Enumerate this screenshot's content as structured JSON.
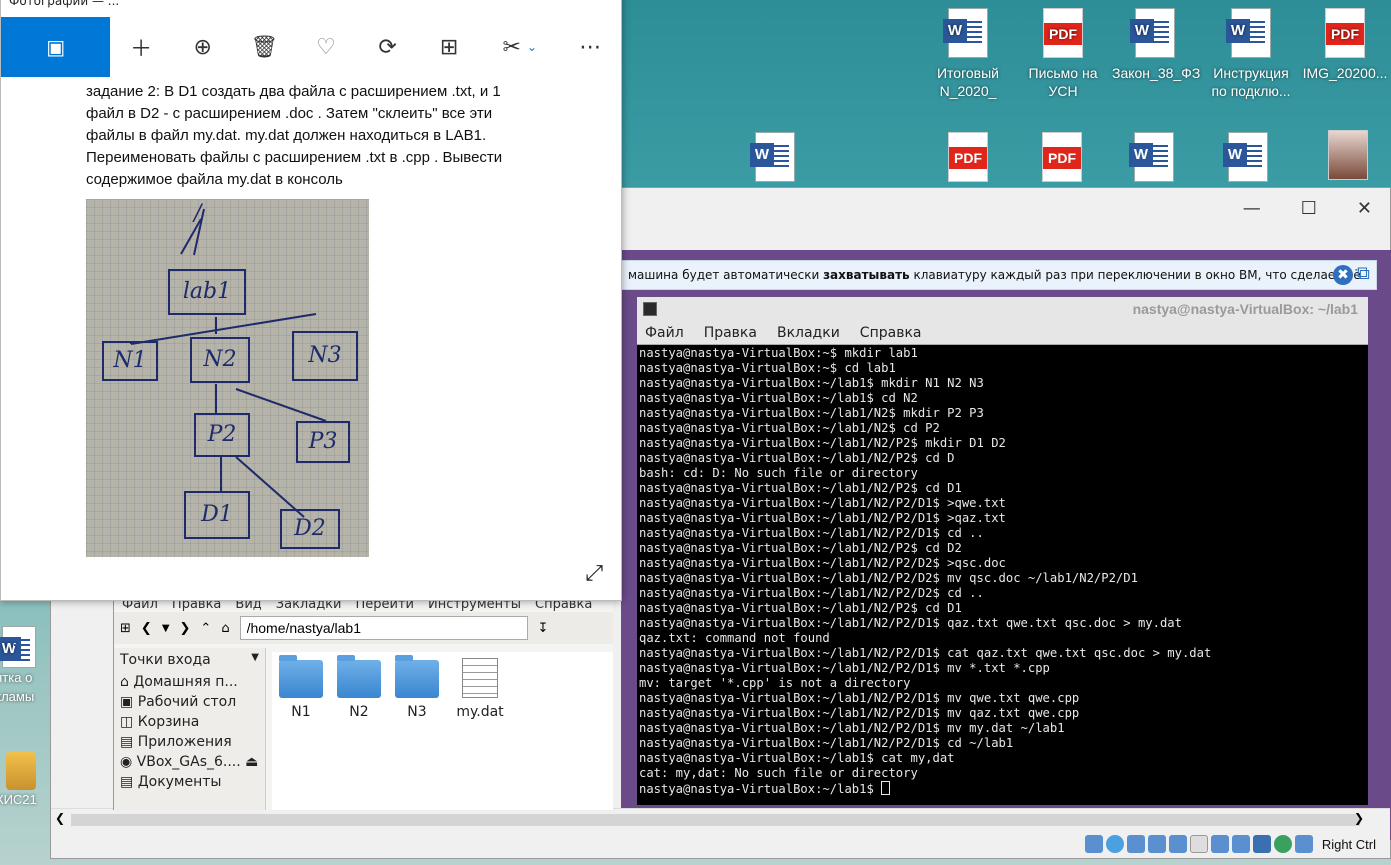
{
  "desktop": {
    "icons_row1": [
      {
        "label": "Итоговый N_2020_",
        "type": "word"
      },
      {
        "label": "Письмо на УСН",
        "type": "pdf"
      },
      {
        "label": "Закон_38_ФЗ",
        "type": "word"
      },
      {
        "label": "Инструкция по подклю...",
        "type": "word"
      },
      {
        "label": "IMG_20200...",
        "type": "pdf"
      }
    ],
    "left_icons": [
      {
        "label": "иятка о екламы"
      },
      {
        "label": "КИС21"
      }
    ]
  },
  "photos": {
    "title": "Фотографии — ...",
    "task_text": "задание 2: В D1 создать два файла с расширением .txt, и 1 файл в D2 - с расширением .doc . Затем \"склеить\" все эти файлы в файл my.dat. my.dat должен находиться в LAB1. Переименовать файлы с расширением .txt в .cpp . Вывести содержимое файла my.dat в консоль",
    "diagram_nodes": [
      "/",
      "lab1",
      "N1",
      "N2",
      "N3",
      "P2",
      "P3",
      "D1",
      "D2"
    ]
  },
  "file_manager": {
    "menu": [
      "Файл",
      "Правка",
      "Вид",
      "Закладки",
      "Перейти",
      "Инструменты",
      "Справка"
    ],
    "path": "/home/nastya/lab1",
    "sidebar_header": "Точки входа",
    "sidebar_items": [
      "Домашняя п...",
      "Рабочий стол",
      "Корзина",
      "Приложения",
      "VBox_GAs_6....",
      "Документы"
    ],
    "files": [
      {
        "name": "N1",
        "type": "folder"
      },
      {
        "name": "N2",
        "type": "folder"
      },
      {
        "name": "N3",
        "type": "folder"
      },
      {
        "name": "my.dat",
        "type": "file"
      }
    ]
  },
  "vbox": {
    "notice": "машина будет автоматически захватывать клавиатуру каждый раз при переключении в окно ВМ, что сделает её",
    "right_ctrl": "Right Ctrl"
  },
  "terminal": {
    "title": "nastya@nastya-VirtualBox: ~/lab1",
    "menu": [
      "Файл",
      "Правка",
      "Вкладки",
      "Справка"
    ],
    "lines": [
      "nastya@nastya-VirtualBox:~$ mkdir lab1",
      "nastya@nastya-VirtualBox:~$ cd lab1",
      "nastya@nastya-VirtualBox:~/lab1$ mkdir N1 N2 N3",
      "nastya@nastya-VirtualBox:~/lab1$ cd N2",
      "nastya@nastya-VirtualBox:~/lab1/N2$ mkdir P2 P3",
      "nastya@nastya-VirtualBox:~/lab1/N2$ cd P2",
      "nastya@nastya-VirtualBox:~/lab1/N2/P2$ mkdir D1 D2",
      "nastya@nastya-VirtualBox:~/lab1/N2/P2$ cd D",
      "bash: cd: D: No such file or directory",
      "nastya@nastya-VirtualBox:~/lab1/N2/P2$ cd D1",
      "nastya@nastya-VirtualBox:~/lab1/N2/P2/D1$ >qwe.txt",
      "nastya@nastya-VirtualBox:~/lab1/N2/P2/D1$ >qaz.txt",
      "nastya@nastya-VirtualBox:~/lab1/N2/P2/D1$ cd ..",
      "nastya@nastya-VirtualBox:~/lab1/N2/P2$ cd D2",
      "nastya@nastya-VirtualBox:~/lab1/N2/P2/D2$ >qsc.doc",
      "nastya@nastya-VirtualBox:~/lab1/N2/P2/D2$ mv qsc.doc ~/lab1/N2/P2/D1",
      "nastya@nastya-VirtualBox:~/lab1/N2/P2/D2$ cd ..",
      "nastya@nastya-VirtualBox:~/lab1/N2/P2$ cd D1",
      "nastya@nastya-VirtualBox:~/lab1/N2/P2/D1$ qaz.txt qwe.txt qsc.doc > my.dat",
      "qaz.txt: command not found",
      "nastya@nastya-VirtualBox:~/lab1/N2/P2/D1$ cat qaz.txt qwe.txt qsc.doc > my.dat",
      "nastya@nastya-VirtualBox:~/lab1/N2/P2/D1$ mv *.txt *.cpp",
      "mv: target '*.cpp' is not a directory",
      "nastya@nastya-VirtualBox:~/lab1/N2/P2/D1$ mv qwe.txt qwe.cpp",
      "nastya@nastya-VirtualBox:~/lab1/N2/P2/D1$ mv qaz.txt qwe.cpp",
      "nastya@nastya-VirtualBox:~/lab1/N2/P2/D1$ mv my.dat ~/lab1",
      "nastya@nastya-VirtualBox:~/lab1/N2/P2/D1$ cd ~/lab1",
      "nastya@nastya-VirtualBox:~/lab1$ cat my,dat",
      "cat: my,dat: No such file or directory",
      "nastya@nastya-VirtualBox:~/lab1$ "
    ]
  }
}
